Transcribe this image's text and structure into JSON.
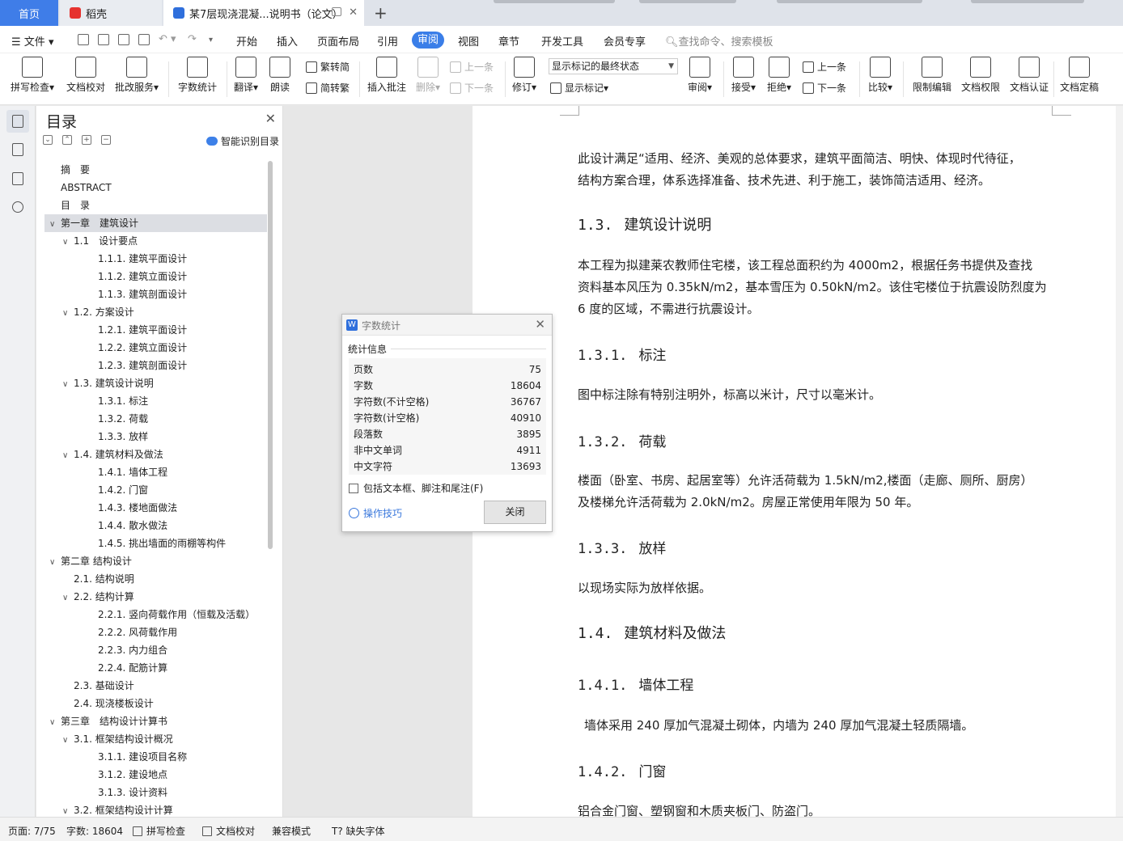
{
  "tabs": {
    "home": "首页",
    "daoke": "稻壳",
    "document": "某7层现浇混凝...说明书（论文）"
  },
  "menubar": {
    "file": "文件",
    "items": [
      "开始",
      "插入",
      "页面布局",
      "引用",
      "审阅",
      "视图",
      "章节",
      "开发工具",
      "会员专享"
    ],
    "search_placeholder": "查找命令、搜索模板"
  },
  "ribbon": {
    "spell_check": "拼写检查",
    "doc_proof": "文档校对",
    "correction_service": "批改服务",
    "word_count": "字数统计",
    "translate": "翻译",
    "read_aloud": "朗读",
    "trad_to_simp": "繁转简",
    "simp_to_trad": "简转繁",
    "insert_comment": "插入批注",
    "delete": "删除",
    "prev_comment": "上一条",
    "next_comment": "下一条",
    "revise": "修订",
    "markup_state": "显示标记的最终状态",
    "show_markup": "显示标记",
    "review": "审阅",
    "accept": "接受",
    "reject": "拒绝",
    "prev_change": "上一条",
    "next_change": "下一条",
    "compare": "比较",
    "restrict_edit": "限制编辑",
    "doc_permission": "文档权限",
    "doc_certify": "文档认证",
    "doc_finalize": "文档定稿"
  },
  "toc": {
    "title": "目录",
    "smart_button": "智能识别目录",
    "items": [
      {
        "text": "摘　要",
        "level": 0,
        "arrow": ""
      },
      {
        "text": "ABSTRACT",
        "level": 0,
        "arrow": ""
      },
      {
        "text": "目　录",
        "level": 0,
        "arrow": ""
      },
      {
        "text": "第一章　建筑设计",
        "level": 0,
        "arrow": "v",
        "selected": true
      },
      {
        "text": "1.1　设计要点",
        "level": 1,
        "arrow": "v"
      },
      {
        "text": "1.1.1.  建筑平面设计",
        "level": 2,
        "arrow": ""
      },
      {
        "text": "1.1.2.  建筑立面设计",
        "level": 2,
        "arrow": ""
      },
      {
        "text": "1.1.3.  建筑剖面设计",
        "level": 2,
        "arrow": ""
      },
      {
        "text": "1.2.  方案设计",
        "level": 1,
        "arrow": "v"
      },
      {
        "text": "1.2.1.  建筑平面设计",
        "level": 2,
        "arrow": ""
      },
      {
        "text": "1.2.2.  建筑立面设计",
        "level": 2,
        "arrow": ""
      },
      {
        "text": "1.2.3.  建筑剖面设计",
        "level": 2,
        "arrow": ""
      },
      {
        "text": "1.3.  建筑设计说明",
        "level": 1,
        "arrow": "v"
      },
      {
        "text": "1.3.1.  标注",
        "level": 2,
        "arrow": ""
      },
      {
        "text": "1.3.2.  荷载",
        "level": 2,
        "arrow": ""
      },
      {
        "text": "1.3.3.  放样",
        "level": 2,
        "arrow": ""
      },
      {
        "text": "1.4.  建筑材料及做法",
        "level": 1,
        "arrow": "v"
      },
      {
        "text": "1.4.1.  墙体工程",
        "level": 2,
        "arrow": ""
      },
      {
        "text": "1.4.2.  门窗",
        "level": 2,
        "arrow": ""
      },
      {
        "text": "1.4.3.  楼地面做法",
        "level": 2,
        "arrow": ""
      },
      {
        "text": "1.4.4.  散水做法",
        "level": 2,
        "arrow": ""
      },
      {
        "text": "1.4.5.  挑出墙面的雨棚等构件",
        "level": 2,
        "arrow": ""
      },
      {
        "text": "第二章  结构设计",
        "level": 0,
        "arrow": "v"
      },
      {
        "text": "2.1.  结构说明",
        "level": 1,
        "arrow": ""
      },
      {
        "text": "2.2.  结构计算",
        "level": 1,
        "arrow": "v"
      },
      {
        "text": "2.2.1.  竖向荷载作用（恒载及活载）",
        "level": 2,
        "arrow": ""
      },
      {
        "text": "2.2.2.  风荷载作用",
        "level": 2,
        "arrow": ""
      },
      {
        "text": "2.2.3.  内力组合",
        "level": 2,
        "arrow": ""
      },
      {
        "text": "2.2.4.  配筋计算",
        "level": 2,
        "arrow": ""
      },
      {
        "text": "2.3.  基础设计",
        "level": 1,
        "arrow": ""
      },
      {
        "text": "2.4.  现浇楼板设计",
        "level": 1,
        "arrow": ""
      },
      {
        "text": "第三章　结构设计计算书",
        "level": 0,
        "arrow": "v"
      },
      {
        "text": "3.1.  框架结构设计概况",
        "level": 1,
        "arrow": "v"
      },
      {
        "text": "3.1.1.  建设项目名称",
        "level": 2,
        "arrow": ""
      },
      {
        "text": "3.1.2.  建设地点",
        "level": 2,
        "arrow": ""
      },
      {
        "text": "3.1.3.  设计资料",
        "level": 2,
        "arrow": ""
      },
      {
        "text": "3.2.  框架结构设计计算",
        "level": 1,
        "arrow": "v"
      }
    ]
  },
  "document": {
    "p_intro_1": "此设计满足“适用、经济、美观的总体要求，建筑平面简洁、明快、体现时代待征，",
    "p_intro_2": "结构方案合理，体系选择准备、技术先进、利于施工，装饰简洁适用、经济。",
    "h_1_3_num": "1.3.",
    "h_1_3": "建筑设计说明",
    "p_1_3_1": "本工程为拟建莱农教师住宅楼，该工程总面积约为 4000m2，根据任务书提供及查找",
    "p_1_3_2": "资料基本风压为 0.35kN/m2，基本雪压为 0.50kN/m2。该住宅楼位于抗震设防烈度为",
    "p_1_3_3": "6 度的区域，不需进行抗震设计。",
    "h_1_3_1_num": "1.3.1.",
    "h_1_3_1": "标注",
    "p_1_3_1_text": "图中标注除有特别注明外，标高以米计，尺寸以毫米计。",
    "h_1_3_2_num": "1.3.2.",
    "h_1_3_2": "荷载",
    "p_load_1": "楼面（卧室、书房、起居室等）允许活荷载为 1.5kN/m2,楼面（走廊、厕所、厨房）",
    "p_load_2": "及楼梯允许活荷载为 2.0kN/m2。房屋正常使用年限为 50 年。",
    "h_1_3_3_num": "1.3.3.",
    "h_1_3_3": "放样",
    "p_layout": "以现场实际为放样依据。",
    "h_1_4_num": "1.4.",
    "h_1_4": "建筑材料及做法",
    "h_1_4_1_num": "1.4.1.",
    "h_1_4_1": "墙体工程",
    "p_wall": "墙体采用 240 厚加气混凝土砌体，内墙为 240 厚加气混凝土轻质隔墙。",
    "h_1_4_2_num": "1.4.2.",
    "h_1_4_2": "门窗",
    "p_window": "铝合金门窗、塑钢窗和木质夹板门、防盗门。"
  },
  "dialog": {
    "title": "字数统计",
    "section": "统计信息",
    "stats": [
      {
        "label": "页数",
        "value": "75"
      },
      {
        "label": "字数",
        "value": "18604"
      },
      {
        "label": "字符数(不计空格)",
        "value": "36767"
      },
      {
        "label": "字符数(计空格)",
        "value": "40910"
      },
      {
        "label": "段落数",
        "value": "3895"
      },
      {
        "label": "非中文单词",
        "value": "4911"
      },
      {
        "label": "中文字符",
        "value": "13693"
      }
    ],
    "checkbox_label": "包括文本框、脚注和尾注(F)",
    "tips": "操作技巧",
    "close": "关闭"
  },
  "statusbar": {
    "page": "页面: 7/75",
    "words": "字数: 18604",
    "spell_check": "拼写检查",
    "doc_proof": "文档校对",
    "compat_mode": "兼容模式",
    "missing_fonts": "缺失字体"
  },
  "colors": {
    "accent": "#3a7ee8",
    "link": "#3a78dc"
  }
}
